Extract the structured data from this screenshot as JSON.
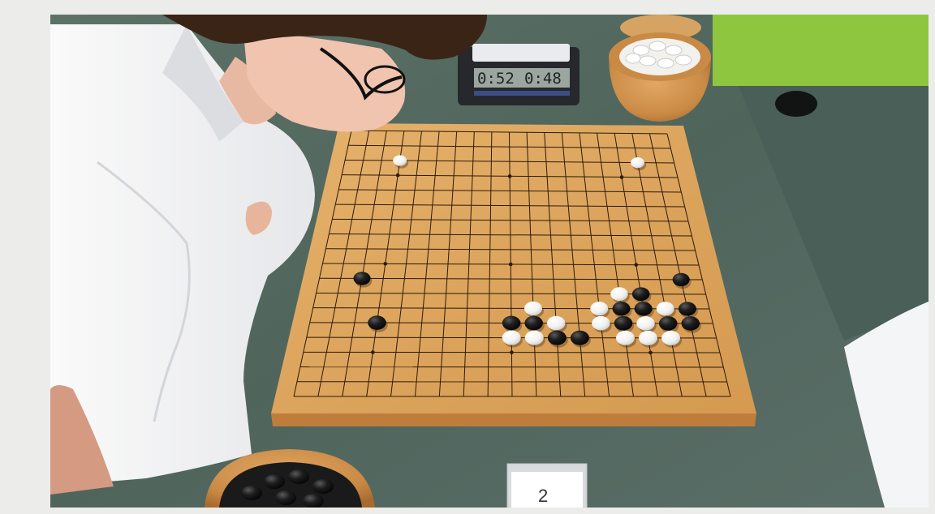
{
  "clock": {
    "left_time": "0:52",
    "right_time": "0:48"
  },
  "table_number": "2",
  "board": {
    "size": 19,
    "star_points": [
      [
        3,
        3
      ],
      [
        3,
        9
      ],
      [
        3,
        15
      ],
      [
        9,
        3
      ],
      [
        9,
        9
      ],
      [
        9,
        15
      ],
      [
        15,
        3
      ],
      [
        15,
        9
      ],
      [
        15,
        15
      ]
    ],
    "stones": [
      {
        "color": "white",
        "col": 3,
        "row": 2
      },
      {
        "color": "white",
        "col": 16,
        "row": 2
      },
      {
        "color": "black",
        "col": 2,
        "row": 10
      },
      {
        "color": "black",
        "col": 3,
        "row": 13
      },
      {
        "color": "black",
        "col": 17,
        "row": 10
      },
      {
        "color": "white",
        "col": 14,
        "row": 11
      },
      {
        "color": "black",
        "col": 15,
        "row": 11
      },
      {
        "color": "white",
        "col": 10,
        "row": 12
      },
      {
        "color": "white",
        "col": 13,
        "row": 12
      },
      {
        "color": "black",
        "col": 14,
        "row": 12
      },
      {
        "color": "black",
        "col": 15,
        "row": 12
      },
      {
        "color": "white",
        "col": 16,
        "row": 12
      },
      {
        "color": "black",
        "col": 17,
        "row": 12
      },
      {
        "color": "black",
        "col": 9,
        "row": 13
      },
      {
        "color": "black",
        "col": 10,
        "row": 13
      },
      {
        "color": "white",
        "col": 11,
        "row": 13
      },
      {
        "color": "white",
        "col": 13,
        "row": 13
      },
      {
        "color": "black",
        "col": 14,
        "row": 13
      },
      {
        "color": "white",
        "col": 15,
        "row": 13
      },
      {
        "color": "black",
        "col": 16,
        "row": 13
      },
      {
        "color": "black",
        "col": 17,
        "row": 13
      },
      {
        "color": "white",
        "col": 9,
        "row": 14
      },
      {
        "color": "white",
        "col": 10,
        "row": 14
      },
      {
        "color": "black",
        "col": 11,
        "row": 14
      },
      {
        "color": "black",
        "col": 12,
        "row": 14
      },
      {
        "color": "white",
        "col": 14,
        "row": 14
      },
      {
        "color": "white",
        "col": 15,
        "row": 14
      },
      {
        "color": "white",
        "col": 16,
        "row": 14
      }
    ]
  }
}
